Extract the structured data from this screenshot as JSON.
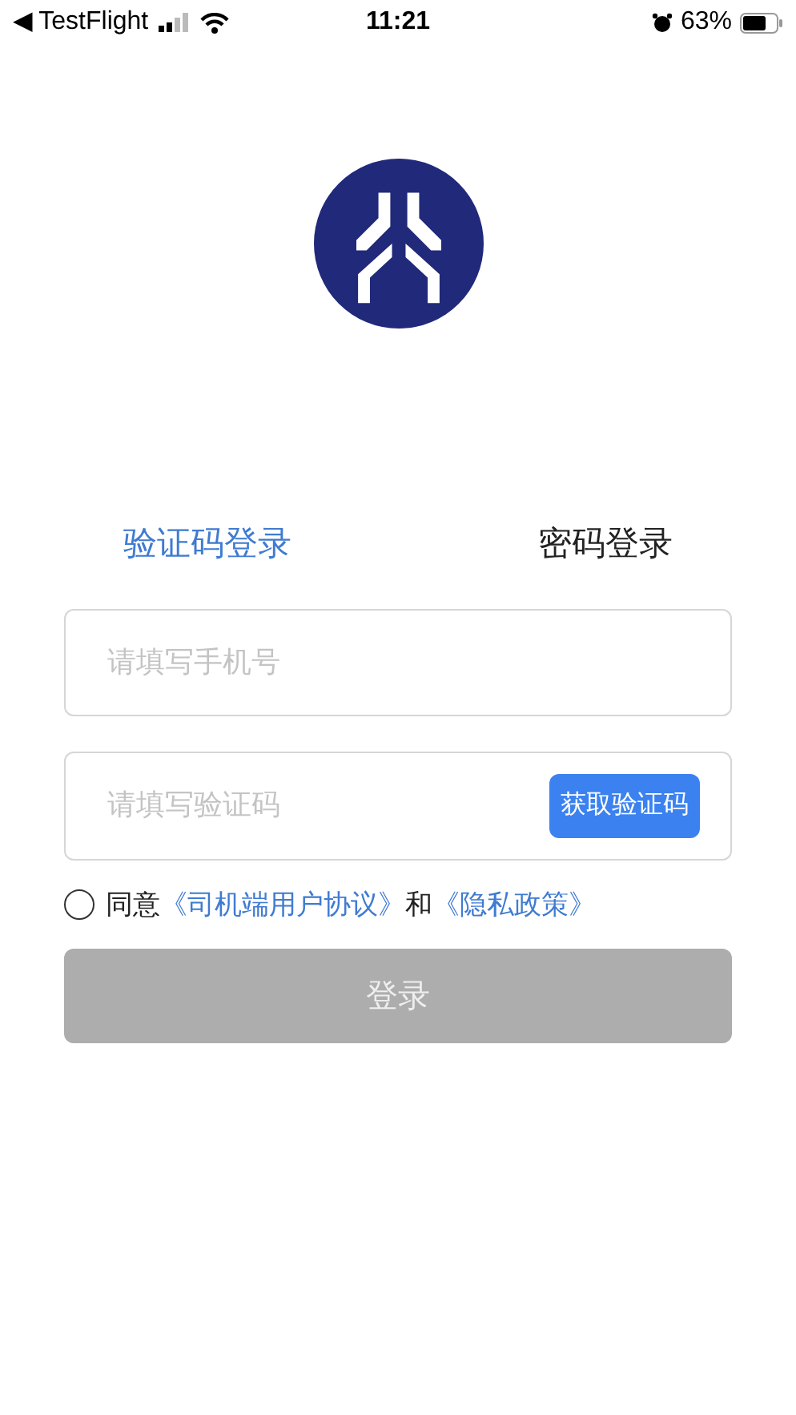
{
  "status_bar": {
    "back_app": "◀ TestFlight",
    "time": "11:21",
    "battery": "63%"
  },
  "tabs": [
    {
      "label": "验证码登录",
      "selected": true
    },
    {
      "label": "密码登录",
      "selected": false
    }
  ],
  "phone_field": {
    "placeholder": "请填写手机号"
  },
  "code_field": {
    "placeholder": "请填写验证码",
    "button": "获取验证码"
  },
  "agreement": {
    "checked": false,
    "prefix": "同意",
    "link_1": "《司机端用户协议》",
    "joiner": "和",
    "link_2": "《隐私政策》"
  },
  "login_button": {
    "label": "登录",
    "disabled": true
  }
}
